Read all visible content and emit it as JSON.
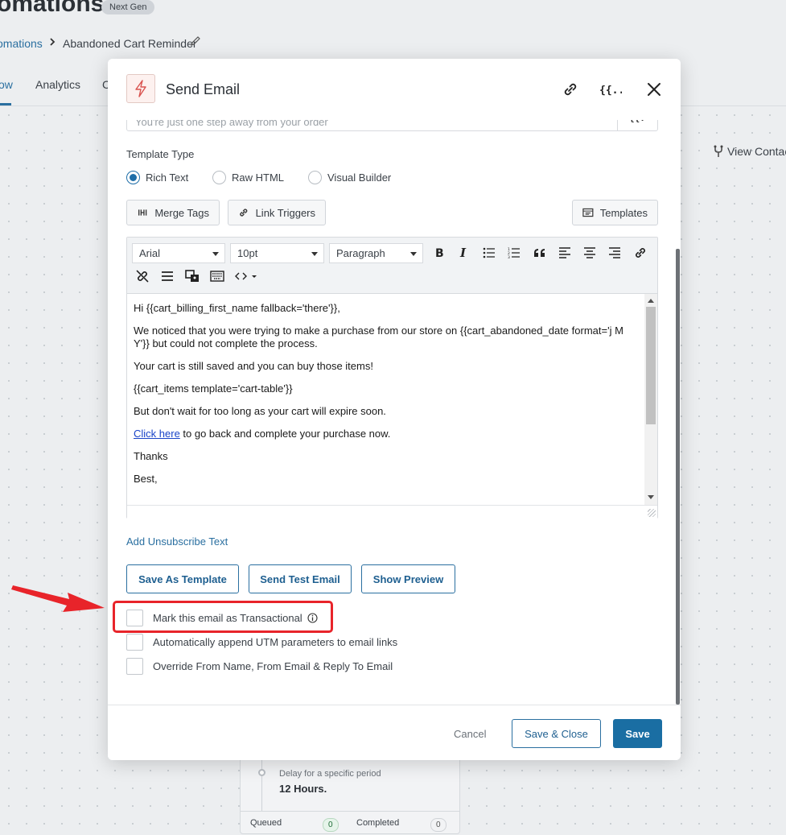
{
  "page": {
    "title": "omations",
    "badge": "Next Gen",
    "breadcrumb": {
      "parent": "omations",
      "current": "Abandoned Cart Reminder"
    },
    "tabs": [
      {
        "label": "ow"
      },
      {
        "label": "Analytics"
      },
      {
        "label": "C"
      }
    ],
    "view_contacts": "View Contac",
    "step": {
      "subtitle": "Delay for a specific period",
      "value": "12 Hours.",
      "queued_label": "Queued",
      "queued_count": "0",
      "completed_label": "Completed",
      "completed_count": "0"
    }
  },
  "modal": {
    "title": "Send Email",
    "subject_value": "You're just one step away from your order",
    "template_type": {
      "label": "Template Type",
      "options": [
        {
          "label": "Rich Text",
          "checked": true
        },
        {
          "label": "Raw HTML",
          "checked": false
        },
        {
          "label": "Visual Builder",
          "checked": false
        }
      ]
    },
    "buttons": {
      "merge_tags": "Merge Tags",
      "link_triggers": "Link Triggers",
      "templates": "Templates",
      "save_as_template": "Save As Template",
      "send_test_email": "Send Test Email",
      "show_preview": "Show Preview"
    },
    "editor": {
      "font_family": "Arial",
      "font_size": "10pt",
      "block_format": "Paragraph",
      "content": {
        "p1": "Hi {{cart_billing_first_name fallback='there'}},",
        "p2": "We noticed that you were trying to make a purchase from our store on {{cart_abandoned_date format='j M Y'}} but could not complete the process.",
        "p3": "Your cart is still saved and you can buy those items!",
        "p4": "{{cart_items template='cart-table'}}",
        "p5": "But don't wait for too long as your cart will expire soon.",
        "p6_link": "Click here",
        "p6_rest": " to go back and complete your purchase now.",
        "p7": "Thanks",
        "p8": "Best,"
      }
    },
    "add_unsubscribe": "Add Unsubscribe Text",
    "checkboxes": [
      {
        "label": "Mark this email as Transactional",
        "checked": false
      },
      {
        "label": "Automatically append UTM parameters to email links",
        "checked": false
      },
      {
        "label": "Override From Name, From Email & Reply To Email",
        "checked": false
      }
    ],
    "footer": {
      "cancel": "Cancel",
      "save_close": "Save & Close",
      "save": "Save"
    }
  },
  "colors": {
    "primary": "#1a6ea3",
    "highlight": "#e8242a",
    "link": "#2a6fa0"
  }
}
